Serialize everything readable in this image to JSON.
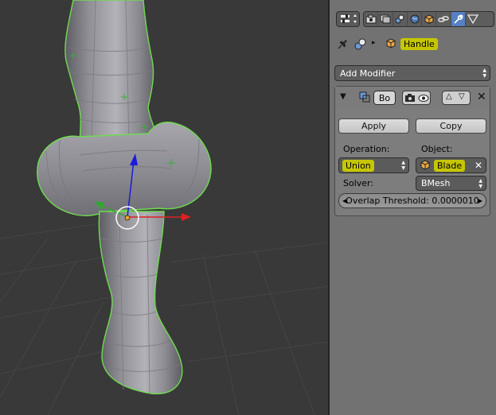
{
  "breadcrumb": {
    "object_name": "Handle"
  },
  "tabs": [
    {
      "name": "render-tab",
      "active": false
    },
    {
      "name": "render-layers-tab",
      "active": false
    },
    {
      "name": "scene-tab",
      "active": false
    },
    {
      "name": "world-tab",
      "active": false
    },
    {
      "name": "object-tab",
      "active": false
    },
    {
      "name": "constraints-tab",
      "active": false
    },
    {
      "name": "modifiers-tab",
      "active": true
    },
    {
      "name": "data-tab",
      "active": false
    }
  ],
  "add_modifier": {
    "label": "Add Modifier"
  },
  "modifier": {
    "name_value": "Bo",
    "apply_label": "Apply",
    "copy_label": "Copy",
    "operation_label": "Operation:",
    "operation_value": "Union",
    "object_label": "Object:",
    "object_value": "Blade",
    "solver_label": "Solver:",
    "solver_value": "BMesh",
    "overlap_label": "Overlap Threshold: 0.0000010"
  },
  "colors": {
    "highlight": "#c6c600",
    "viewport_bg": "#393939",
    "panel_bg": "#727272",
    "active_tab": "#5680c2",
    "selection_outline": "#6fdc4f",
    "axis_x": "#e02020",
    "axis_y": "#2fa82f",
    "axis_z": "#1a1ae0"
  }
}
